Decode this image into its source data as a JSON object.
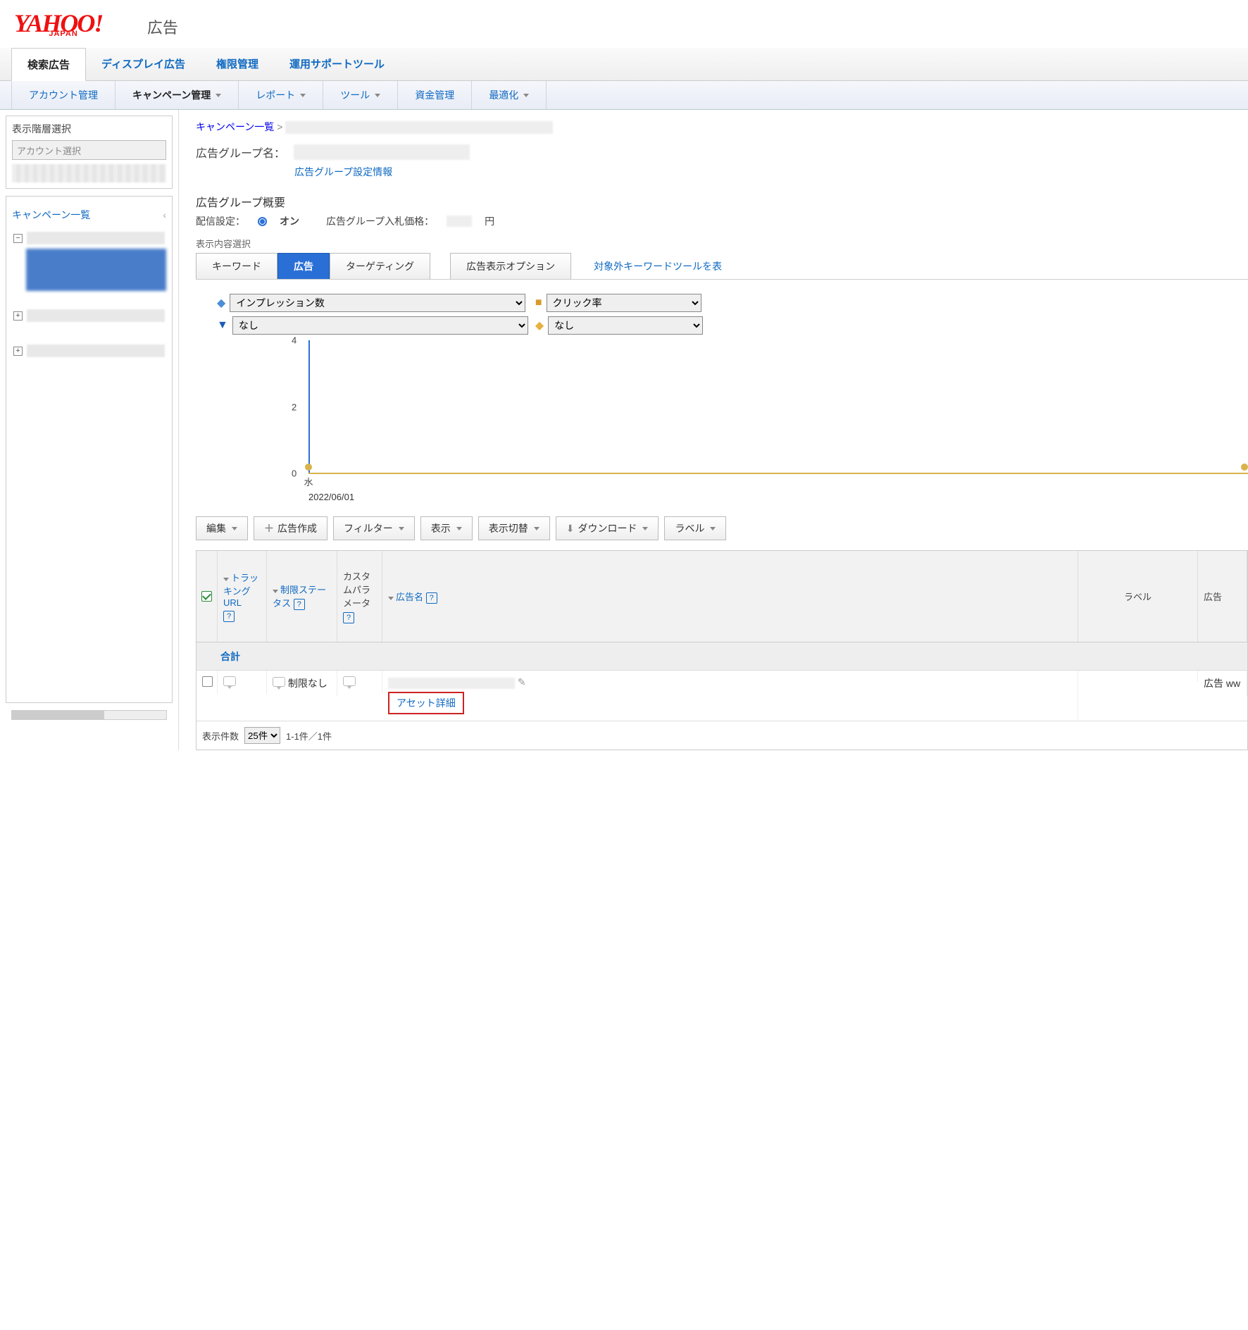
{
  "logo": {
    "brand_main": "YAHOO!",
    "brand_sub": "JAPAN",
    "suffix": "広告"
  },
  "top_tabs": [
    "検索広告",
    "ディスプレイ広告",
    "権限管理",
    "運用サポートツール"
  ],
  "sub_nav": [
    "アカウント管理",
    "キャンペーン管理",
    "レポート",
    "ツール",
    "資金管理",
    "最適化"
  ],
  "sidebar": {
    "level_title": "表示階層選択",
    "account_select_placeholder": "アカウント選択",
    "campaign_list_label": "キャンペーン一覧",
    "tree_collapse": "−",
    "tree_expand": "+"
  },
  "breadcrumb": {
    "campaign_list": "キャンペーン一覧",
    "sep": ">"
  },
  "group": {
    "name_label": "広告グループ名：",
    "settings_link": "広告グループ設定情報",
    "overview_title": "広告グループ概要",
    "delivery_label": "配信設定：",
    "delivery_on": "オン",
    "bid_label": "広告グループ入札価格：",
    "bid_unit": "円"
  },
  "content_select_label": "表示内容選択",
  "content_tabs": [
    "キーワード",
    "広告",
    "ターゲティング",
    "広告表示オプション"
  ],
  "excluded_kw_link": "対象外キーワードツールを表",
  "metric_selects": {
    "m1": "インプレッション数",
    "m2": "なし",
    "m3": "クリック率",
    "m4": "なし"
  },
  "chart_data": {
    "type": "line",
    "x": [
      "2022/06/01"
    ],
    "xtick_labels": [
      "水"
    ],
    "series": [
      {
        "name": "インプレッション数",
        "values": [
          0
        ],
        "color": "#4a8fd6"
      },
      {
        "name": "クリック率",
        "values": [
          0
        ],
        "color": "#d8b34a"
      }
    ],
    "ylim": [
      0,
      4
    ],
    "yticks": [
      0,
      2,
      4
    ],
    "xlabel": "",
    "ylabel": "",
    "title": ""
  },
  "toolbar": {
    "edit": "編集",
    "create_ad": "広告作成",
    "filter": "フィルター",
    "display": "表示",
    "display_switch": "表示切替",
    "download": "ダウンロード",
    "label": "ラベル"
  },
  "table": {
    "headers": {
      "tracking_url": "トラッキングURL",
      "limit_status": "制限ステータス",
      "custom_param": "カスタムパラメータ",
      "ad_name": "広告名",
      "label": "ラベル",
      "ad": "広告"
    },
    "help_char": "?",
    "total_label": "合計",
    "rows": [
      {
        "limit_status": "制限なし",
        "asset_detail": "アセット詳細",
        "ad_preview": "広告 ww"
      }
    ]
  },
  "footer": {
    "rows_label": "表示件数",
    "rows_value": "25件",
    "count_text": "1-1件／1件"
  }
}
